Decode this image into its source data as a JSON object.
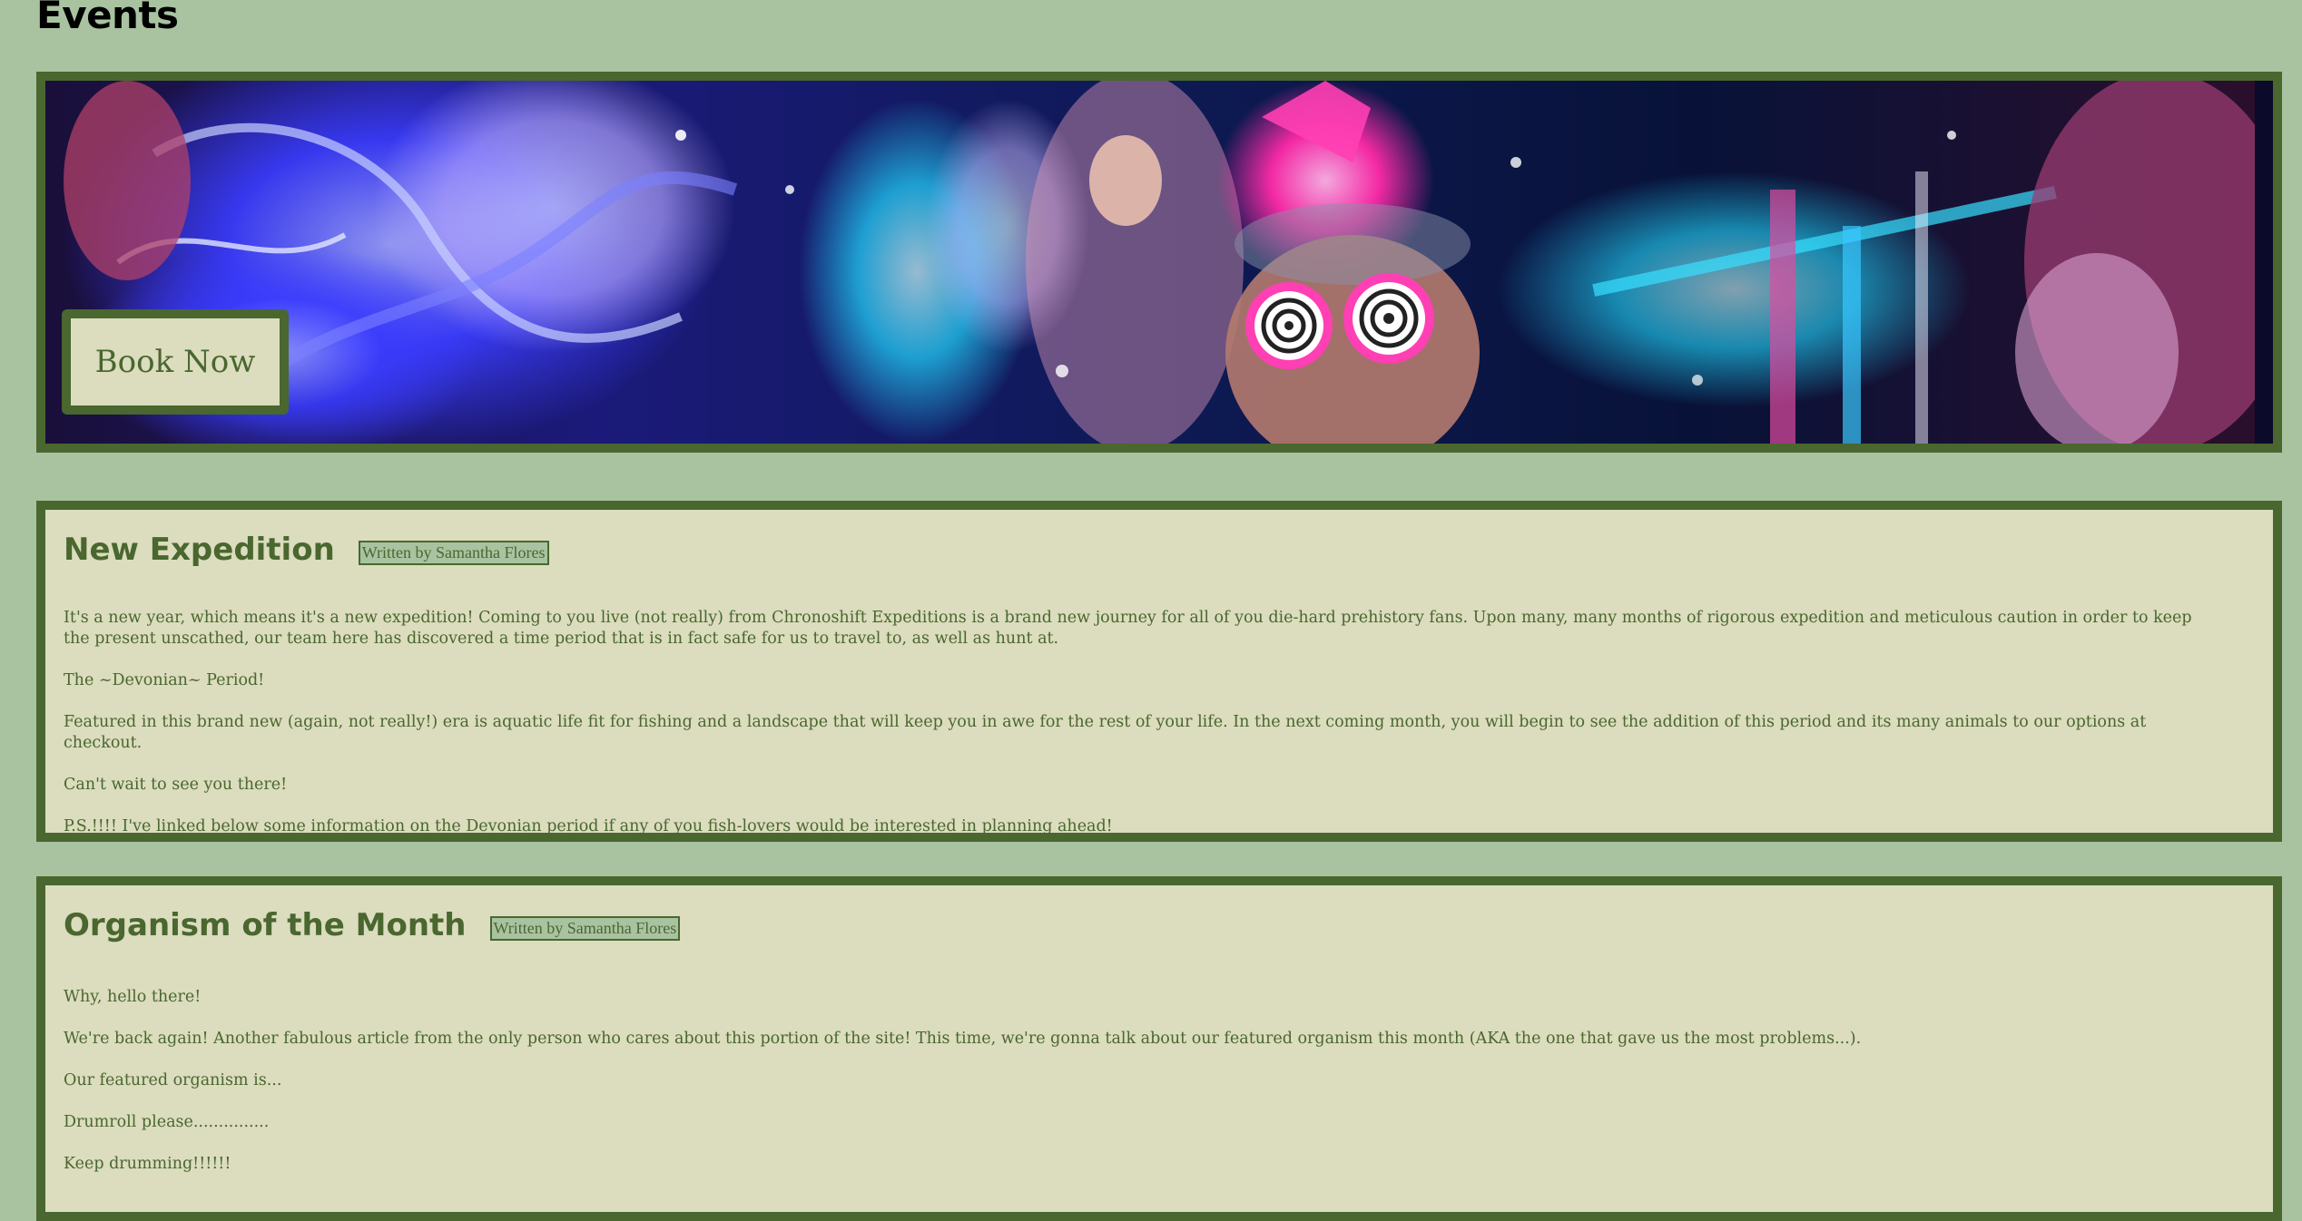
{
  "page": {
    "title": "Events"
  },
  "hero": {
    "image_alt": "Neon robot show photo",
    "book_label": "Book Now"
  },
  "articles": [
    {
      "title": "New Expedition",
      "byline": "Written by Samantha Flores",
      "paragraphs": [
        "It's a new year, which means it's a new expedition! Coming to you live (not really) from Chronoshift Expeditions is a brand new journey for all of you die-hard prehistory fans. Upon many, many months of rigorous expedition and meticulous caution in order to keep the present unscathed, our team here has discovered a time period that is in fact safe for us to travel to, as well as hunt at.",
        "The ~Devonian~ Period!",
        "Featured in this brand new (again, not really!) era is aquatic life fit for fishing and a landscape that will keep you in awe for the rest of your life. In the next coming month, you will begin to see the addition of this period and its many animals to our options at checkout.",
        "Can't wait to see you there!",
        "P.S.!!!! I've linked below some information on the Devonian period if any of you fish-lovers would be interested in planning ahead!"
      ]
    },
    {
      "title": "Organism of the Month",
      "byline": "Written by Samantha Flores",
      "paragraphs": [
        "Why, hello there!",
        "We're back again! Another fabulous article from the only person who cares about this portion of the site! This time, we're gonna talk about our featured organism this month (AKA the one that gave us the most problems...).",
        "Our featured organism is...",
        "Drumroll please...............",
        "Keep drumming!!!!!!"
      ]
    }
  ],
  "colors": {
    "page_background": "#a9c3a1",
    "accent_dark_green": "#49672f",
    "card_background": "#dcdcbe",
    "neon_pink": "#ff2aa8",
    "neon_blue": "#3a3cff",
    "neon_cyan": "#22d8ff"
  }
}
